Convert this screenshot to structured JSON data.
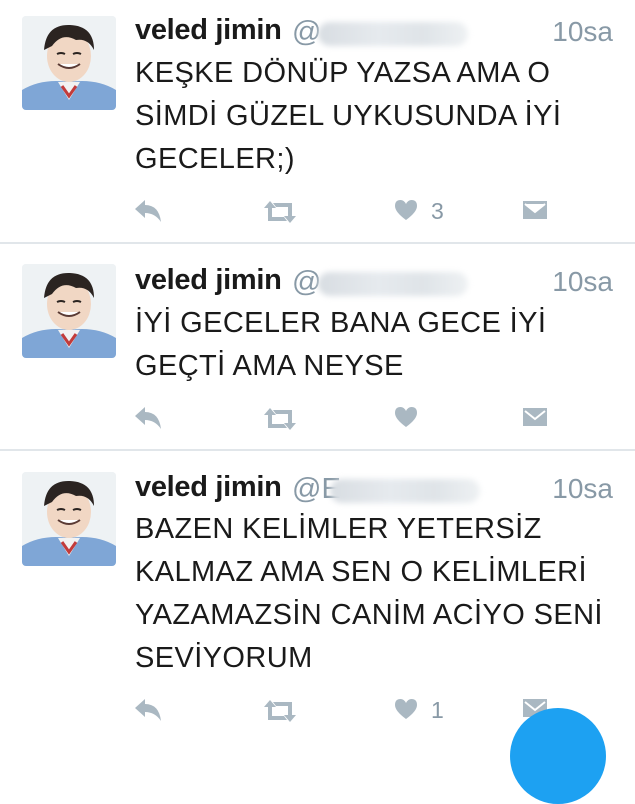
{
  "tweets": [
    {
      "author": "veled jimin",
      "handle_prefix": "@",
      "time": "10sa",
      "lines": [
        "KEŞKE DÖNÜP YAZSA AMA O",
        "SİMDİ GÜZEL UYKUSUNDA İYİ",
        "GECELER;)"
      ],
      "like_count": "3"
    },
    {
      "author": "veled jimin",
      "handle_prefix": "@",
      "time": "10sa",
      "lines": [
        "İYİ GECELER BANA GECE İYİ",
        "GEÇTİ AMA NEYSE"
      ],
      "like_count": ""
    },
    {
      "author": "veled jimin",
      "handle_prefix": "@E",
      "time": "10sa",
      "lines": [
        "BAZEN KELİMLER YETERSİZ",
        "KALMAZ AMA SEN O KELİMLERİ",
        "YAZAMAZSİN CANİM ACİYO SENİ",
        "SEVİYORUM"
      ],
      "like_count": "1"
    }
  ],
  "icons": {
    "reply": "reply-icon",
    "retweet": "retweet-icon",
    "like": "heart-icon",
    "dm": "envelope-icon"
  },
  "colors": {
    "icon": "#aab8c2",
    "muted": "#8899a6",
    "accent": "#1da1f2"
  }
}
